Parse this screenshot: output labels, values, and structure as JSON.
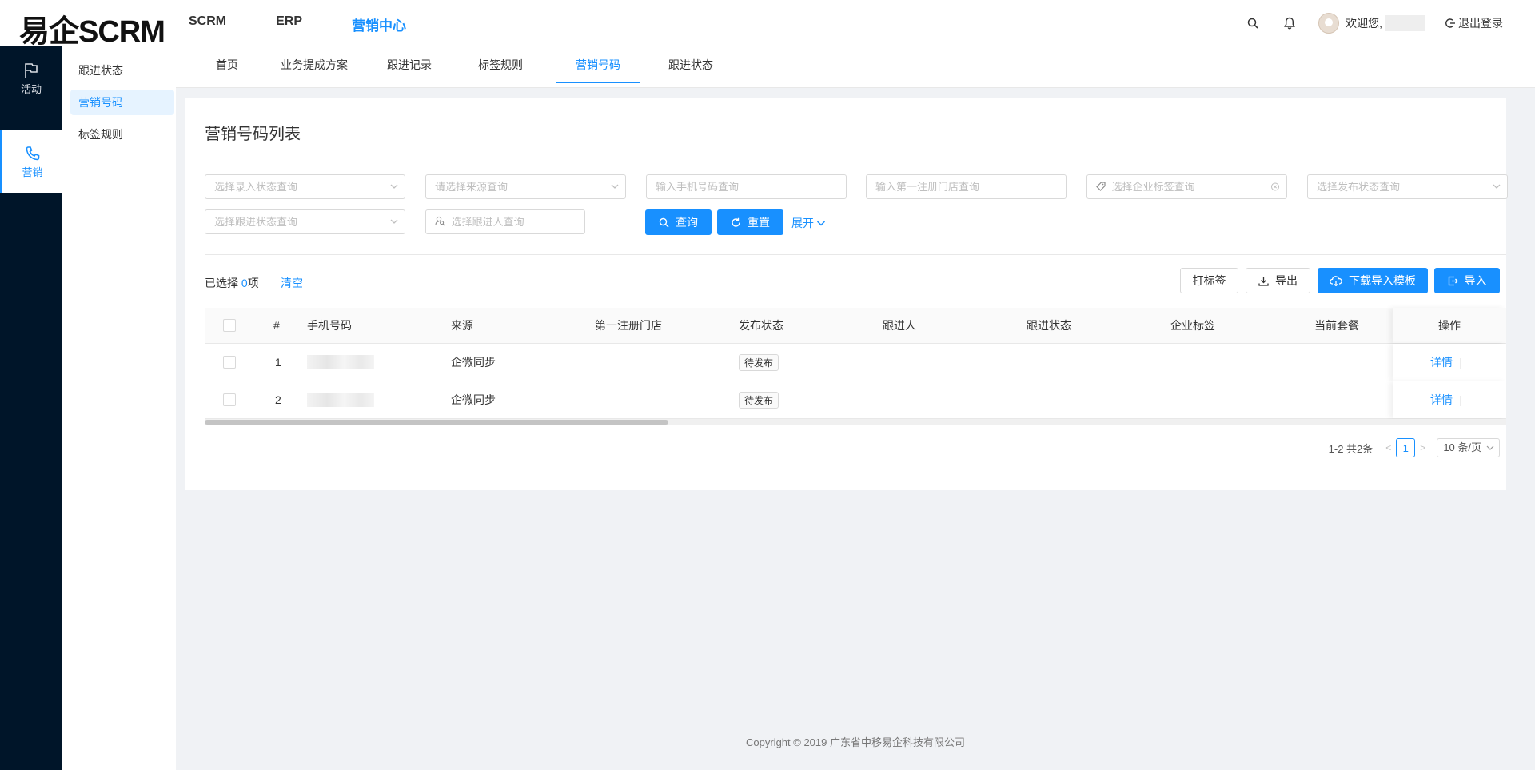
{
  "header": {
    "logo": "易企SCRM",
    "nav": [
      {
        "label": "SCRM",
        "active": false
      },
      {
        "label": "ERP",
        "active": false
      },
      {
        "label": "营销中心",
        "active": true
      }
    ],
    "welcome": "欢迎您,",
    "logout": "退出登录",
    "icons": [
      "search-icon",
      "bell-icon"
    ]
  },
  "sidebar": {
    "items": [
      {
        "label": "活动",
        "icon": "flag-icon",
        "active": false
      },
      {
        "label": "营销",
        "icon": "phone-icon",
        "active": true
      }
    ]
  },
  "submenu": {
    "items": [
      {
        "label": "跟进状态",
        "active": false
      },
      {
        "label": "营销号码",
        "active": true
      },
      {
        "label": "标签规则",
        "active": false
      }
    ]
  },
  "tabs": [
    {
      "label": "首页",
      "active": false
    },
    {
      "label": "业务提成方案",
      "active": false
    },
    {
      "label": "跟进记录",
      "active": false
    },
    {
      "label": "标签规则",
      "active": false
    },
    {
      "label": "营销号码",
      "active": true
    },
    {
      "label": "跟进状态",
      "active": false
    }
  ],
  "page": {
    "title": "营销号码列表"
  },
  "filters": {
    "entry_status": "选择录入状态查询",
    "source": "请选择来源查询",
    "phone": "输入手机号码查询",
    "first_store": "输入第一注册门店查询",
    "enterprise_tag": "选择企业标签查询",
    "publish_status": "选择发布状态查询",
    "follow_status": "选择跟进状态查询",
    "follower": "选择跟进人查询",
    "search_btn": "查询",
    "reset_btn": "重置",
    "expand_link": "展开"
  },
  "toolbar": {
    "selected_prefix": "已选择",
    "selected_count": "0",
    "selected_suffix": "项",
    "clear": "清空",
    "tag_btn": "打标签",
    "export_btn": "导出",
    "download_template_btn": "下载导入模板",
    "import_btn": "导入"
  },
  "table": {
    "headers": {
      "index": "#",
      "phone": "手机号码",
      "source": "来源",
      "first_store": "第一注册门店",
      "publish_status": "发布状态",
      "follower": "跟进人",
      "follow_status": "跟进状态",
      "enterprise_tag": "企业标签",
      "package": "当前套餐",
      "action": "操作"
    },
    "rows": [
      {
        "index": "1",
        "source": "企微同步",
        "publish_status": "待发布",
        "action": "详情"
      },
      {
        "index": "2",
        "source": "企微同步",
        "publish_status": "待发布",
        "action": "详情"
      }
    ]
  },
  "pagination": {
    "summary": "1-2 共2条",
    "current": "1",
    "page_size": "10 条/页"
  },
  "footer": {
    "copyright": "Copyright © 2019 广东省中移易企科技有限公司"
  },
  "colors": {
    "primary": "#1890ff",
    "sidebar_bg": "#001529",
    "page_bg": "#f0f2f5"
  }
}
